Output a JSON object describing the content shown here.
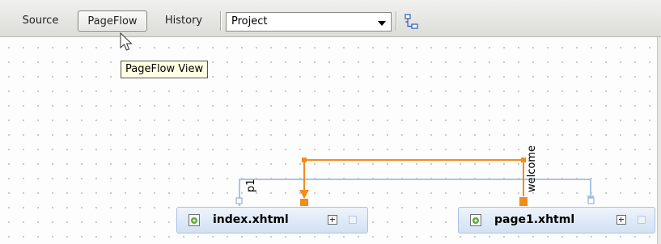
{
  "toolbar": {
    "tabs": [
      {
        "label": "Source"
      },
      {
        "label": "PageFlow",
        "active": true
      },
      {
        "label": "History"
      }
    ],
    "scope_combo": {
      "value": "Project"
    },
    "layout_icon": "layout-pages-icon"
  },
  "tooltip": {
    "text": "PageFlow View"
  },
  "canvas": {
    "pages": [
      {
        "name": "index.xhtml",
        "icon": "xhtml-file-icon"
      },
      {
        "name": "page1.xhtml",
        "icon": "xhtml-file-icon"
      }
    ],
    "links": [
      {
        "label": "p1",
        "from": "index.xhtml",
        "to": "page1.xhtml",
        "color": "#a9c5ea"
      },
      {
        "label": "welcome",
        "from": "page1.xhtml",
        "to": "index.xhtml",
        "color": "#f28c1a"
      }
    ]
  },
  "colors": {
    "accent_orange": "#f28c1a",
    "link_blue": "#a9c5ea",
    "node_border": "#a9c2e3"
  }
}
